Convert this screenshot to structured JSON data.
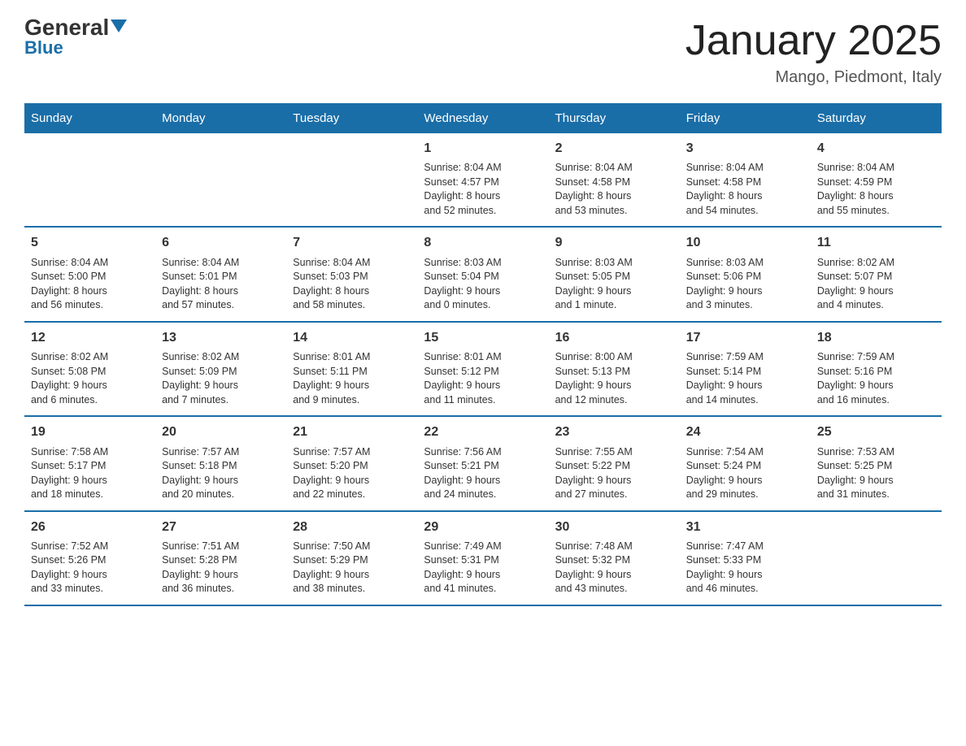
{
  "header": {
    "logo_general": "General",
    "logo_blue": "Blue",
    "title": "January 2025",
    "subtitle": "Mango, Piedmont, Italy"
  },
  "weekdays": [
    "Sunday",
    "Monday",
    "Tuesday",
    "Wednesday",
    "Thursday",
    "Friday",
    "Saturday"
  ],
  "weeks": [
    [
      {
        "day": "",
        "info": ""
      },
      {
        "day": "",
        "info": ""
      },
      {
        "day": "",
        "info": ""
      },
      {
        "day": "1",
        "info": "Sunrise: 8:04 AM\nSunset: 4:57 PM\nDaylight: 8 hours\nand 52 minutes."
      },
      {
        "day": "2",
        "info": "Sunrise: 8:04 AM\nSunset: 4:58 PM\nDaylight: 8 hours\nand 53 minutes."
      },
      {
        "day": "3",
        "info": "Sunrise: 8:04 AM\nSunset: 4:58 PM\nDaylight: 8 hours\nand 54 minutes."
      },
      {
        "day": "4",
        "info": "Sunrise: 8:04 AM\nSunset: 4:59 PM\nDaylight: 8 hours\nand 55 minutes."
      }
    ],
    [
      {
        "day": "5",
        "info": "Sunrise: 8:04 AM\nSunset: 5:00 PM\nDaylight: 8 hours\nand 56 minutes."
      },
      {
        "day": "6",
        "info": "Sunrise: 8:04 AM\nSunset: 5:01 PM\nDaylight: 8 hours\nand 57 minutes."
      },
      {
        "day": "7",
        "info": "Sunrise: 8:04 AM\nSunset: 5:03 PM\nDaylight: 8 hours\nand 58 minutes."
      },
      {
        "day": "8",
        "info": "Sunrise: 8:03 AM\nSunset: 5:04 PM\nDaylight: 9 hours\nand 0 minutes."
      },
      {
        "day": "9",
        "info": "Sunrise: 8:03 AM\nSunset: 5:05 PM\nDaylight: 9 hours\nand 1 minute."
      },
      {
        "day": "10",
        "info": "Sunrise: 8:03 AM\nSunset: 5:06 PM\nDaylight: 9 hours\nand 3 minutes."
      },
      {
        "day": "11",
        "info": "Sunrise: 8:02 AM\nSunset: 5:07 PM\nDaylight: 9 hours\nand 4 minutes."
      }
    ],
    [
      {
        "day": "12",
        "info": "Sunrise: 8:02 AM\nSunset: 5:08 PM\nDaylight: 9 hours\nand 6 minutes."
      },
      {
        "day": "13",
        "info": "Sunrise: 8:02 AM\nSunset: 5:09 PM\nDaylight: 9 hours\nand 7 minutes."
      },
      {
        "day": "14",
        "info": "Sunrise: 8:01 AM\nSunset: 5:11 PM\nDaylight: 9 hours\nand 9 minutes."
      },
      {
        "day": "15",
        "info": "Sunrise: 8:01 AM\nSunset: 5:12 PM\nDaylight: 9 hours\nand 11 minutes."
      },
      {
        "day": "16",
        "info": "Sunrise: 8:00 AM\nSunset: 5:13 PM\nDaylight: 9 hours\nand 12 minutes."
      },
      {
        "day": "17",
        "info": "Sunrise: 7:59 AM\nSunset: 5:14 PM\nDaylight: 9 hours\nand 14 minutes."
      },
      {
        "day": "18",
        "info": "Sunrise: 7:59 AM\nSunset: 5:16 PM\nDaylight: 9 hours\nand 16 minutes."
      }
    ],
    [
      {
        "day": "19",
        "info": "Sunrise: 7:58 AM\nSunset: 5:17 PM\nDaylight: 9 hours\nand 18 minutes."
      },
      {
        "day": "20",
        "info": "Sunrise: 7:57 AM\nSunset: 5:18 PM\nDaylight: 9 hours\nand 20 minutes."
      },
      {
        "day": "21",
        "info": "Sunrise: 7:57 AM\nSunset: 5:20 PM\nDaylight: 9 hours\nand 22 minutes."
      },
      {
        "day": "22",
        "info": "Sunrise: 7:56 AM\nSunset: 5:21 PM\nDaylight: 9 hours\nand 24 minutes."
      },
      {
        "day": "23",
        "info": "Sunrise: 7:55 AM\nSunset: 5:22 PM\nDaylight: 9 hours\nand 27 minutes."
      },
      {
        "day": "24",
        "info": "Sunrise: 7:54 AM\nSunset: 5:24 PM\nDaylight: 9 hours\nand 29 minutes."
      },
      {
        "day": "25",
        "info": "Sunrise: 7:53 AM\nSunset: 5:25 PM\nDaylight: 9 hours\nand 31 minutes."
      }
    ],
    [
      {
        "day": "26",
        "info": "Sunrise: 7:52 AM\nSunset: 5:26 PM\nDaylight: 9 hours\nand 33 minutes."
      },
      {
        "day": "27",
        "info": "Sunrise: 7:51 AM\nSunset: 5:28 PM\nDaylight: 9 hours\nand 36 minutes."
      },
      {
        "day": "28",
        "info": "Sunrise: 7:50 AM\nSunset: 5:29 PM\nDaylight: 9 hours\nand 38 minutes."
      },
      {
        "day": "29",
        "info": "Sunrise: 7:49 AM\nSunset: 5:31 PM\nDaylight: 9 hours\nand 41 minutes."
      },
      {
        "day": "30",
        "info": "Sunrise: 7:48 AM\nSunset: 5:32 PM\nDaylight: 9 hours\nand 43 minutes."
      },
      {
        "day": "31",
        "info": "Sunrise: 7:47 AM\nSunset: 5:33 PM\nDaylight: 9 hours\nand 46 minutes."
      },
      {
        "day": "",
        "info": ""
      }
    ]
  ]
}
